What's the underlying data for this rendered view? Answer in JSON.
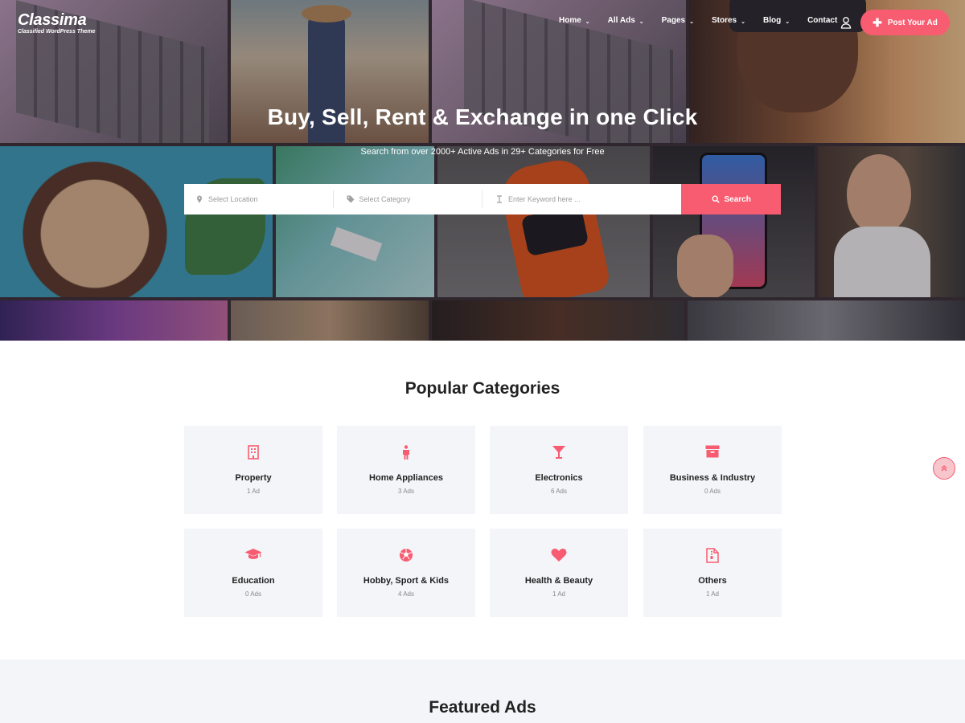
{
  "brand": {
    "name": "Classima",
    "tagline": "Classified WordPress Theme"
  },
  "nav": {
    "items": [
      {
        "label": "Home",
        "dropdown": true
      },
      {
        "label": "All Ads",
        "dropdown": true
      },
      {
        "label": "Pages",
        "dropdown": true
      },
      {
        "label": "Stores",
        "dropdown": true
      },
      {
        "label": "Blog",
        "dropdown": true
      },
      {
        "label": "Contact",
        "dropdown": false
      }
    ],
    "post_ad_label": "Post Your Ad"
  },
  "hero": {
    "title": "Buy, Sell, Rent & Exchange in one Click",
    "subtitle": "Search from over 2000+ Active Ads in 29+ Categories for Free"
  },
  "search": {
    "location_placeholder": "Select Location",
    "category_placeholder": "Select Category",
    "keyword_placeholder": "Enter Keyword here ...",
    "button_label": "Search"
  },
  "categories": {
    "title": "Popular Categories",
    "items": [
      {
        "name": "Property",
        "count": "1 Ad",
        "icon": "building-icon"
      },
      {
        "name": "Home Appliances",
        "count": "3 Ads",
        "icon": "person-icon"
      },
      {
        "name": "Electronics",
        "count": "6 Ads",
        "icon": "cocktail-glass-icon"
      },
      {
        "name": "Business & Industry",
        "count": "0 Ads",
        "icon": "archive-box-icon"
      },
      {
        "name": "Education",
        "count": "0 Ads",
        "icon": "graduation-cap-icon"
      },
      {
        "name": "Hobby, Sport & Kids",
        "count": "4 Ads",
        "icon": "soccer-ball-icon"
      },
      {
        "name": "Health & Beauty",
        "count": "1 Ad",
        "icon": "heart-icon"
      },
      {
        "name": "Others",
        "count": "1 Ad",
        "icon": "file-archive-icon"
      }
    ]
  },
  "featured": {
    "title": "Featured Ads"
  },
  "colors": {
    "accent": "#f85c70",
    "card_bg": "#f4f5f8",
    "heading": "#222222"
  }
}
